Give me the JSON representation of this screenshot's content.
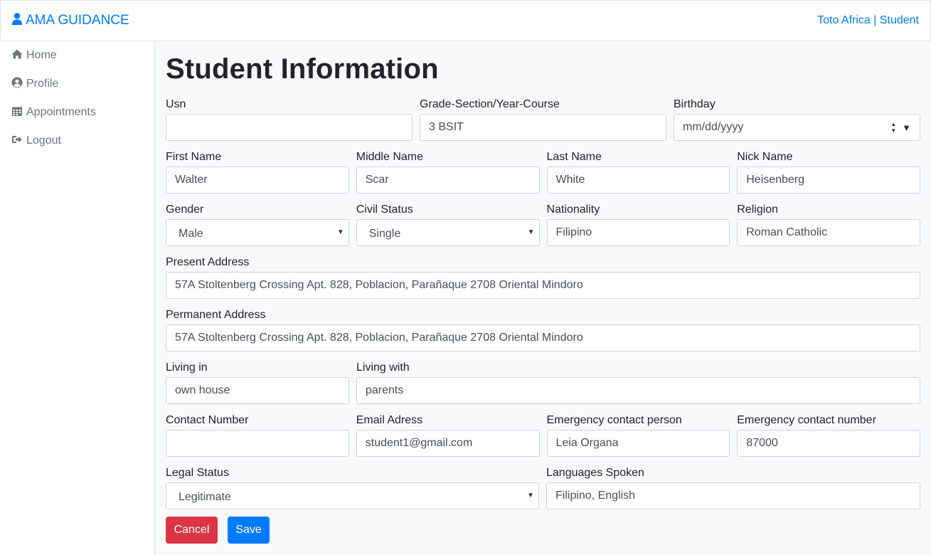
{
  "navbar": {
    "brand": "AMA GUIDANCE",
    "user": "Toto Africa | Student",
    "brand_color": "#007bff"
  },
  "sidebar": {
    "items": [
      {
        "label": "Home",
        "icon": "home-icon"
      },
      {
        "label": "Profile",
        "icon": "user-circle-icon"
      },
      {
        "label": "Appointments",
        "icon": "calendar-icon"
      },
      {
        "label": "Logout",
        "icon": "sign-out-icon"
      }
    ]
  },
  "page": {
    "title": "Student Information"
  },
  "form": {
    "usn": {
      "label": "Usn",
      "value": ""
    },
    "grade": {
      "label": "Grade-Section/Year-Course",
      "value": "3 BSIT"
    },
    "birthday": {
      "label": "Birthday",
      "placeholder": "mm/dd/yyyy"
    },
    "first_name": {
      "label": "First Name",
      "value": "Walter"
    },
    "middle_name": {
      "label": "Middle Name",
      "value": "Scar"
    },
    "last_name": {
      "label": "Last Name",
      "value": "White"
    },
    "nick_name": {
      "label": "Nick Name",
      "value": "Heisenberg"
    },
    "gender": {
      "label": "Gender",
      "value": "Male"
    },
    "civil_status": {
      "label": "Civil Status",
      "value": "Single"
    },
    "nationality": {
      "label": "Nationality",
      "value": "Filipino"
    },
    "religion": {
      "label": "Religion",
      "value": "Roman Catholic"
    },
    "present_address": {
      "label": "Present Address",
      "value": "57A Stoltenberg Crossing Apt. 828, Poblacion, Parañaque 2708 Oriental Mindoro"
    },
    "permanent_address": {
      "label": "Permanent Address",
      "value": "57A Stoltenberg Crossing Apt. 828, Poblacion, Parañaque 2708 Oriental Mindoro"
    },
    "living_in": {
      "label": "Living in",
      "value": "own house"
    },
    "living_with": {
      "label": "Living with",
      "value": "parents"
    },
    "contact_number": {
      "label": "Contact Number",
      "value": ""
    },
    "email": {
      "label": "Email Adress",
      "value": "student1@gmail.com"
    },
    "emergency_person": {
      "label": "Emergency contact person",
      "value": "Leia Organa"
    },
    "emergency_number": {
      "label": "Emergency contact number",
      "value": "87000"
    },
    "legal_status": {
      "label": "Legal Status",
      "value": "Legitimate"
    },
    "languages": {
      "label": "Languages Spoken",
      "value": "Filipino, English"
    }
  },
  "buttons": {
    "cancel": "Cancel",
    "save": "Save",
    "cancel_color": "#dc3545",
    "save_color": "#007bff"
  }
}
